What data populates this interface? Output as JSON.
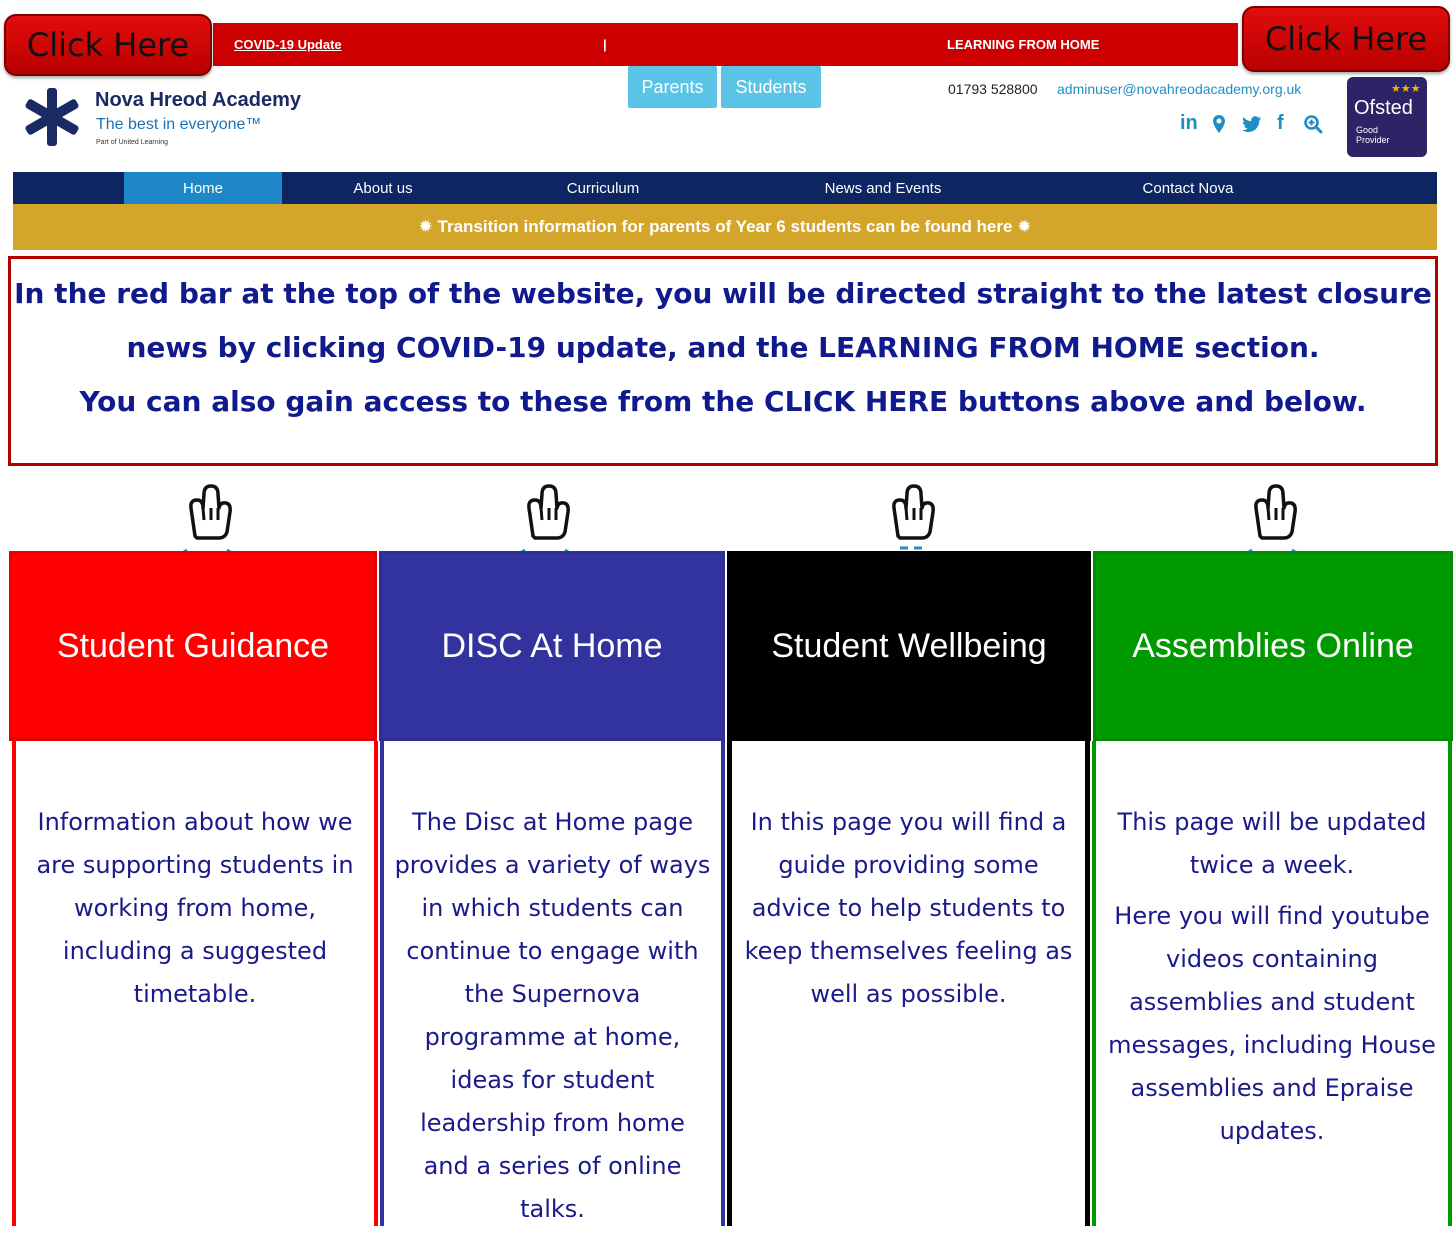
{
  "top_bar": {
    "click_left": "Click Here",
    "click_right": "Click Here",
    "covid_link": "COVID-19 Update",
    "separator": "|",
    "learning_link": "LEARNING FROM HOME"
  },
  "header": {
    "school_name": "Nova Hreod Academy",
    "tagline": "The best in everyone™",
    "sub_tagline": "Part of United Learning",
    "parents_btn": "Parents",
    "students_btn": "Students",
    "phone": "01793 528800",
    "email": "adminuser@novahreodacademy.org.uk",
    "ofsted_name": "Ofsted",
    "ofsted_sub1": "Good",
    "ofsted_sub2": "Provider"
  },
  "nav": {
    "items": [
      "Home",
      "About us",
      "Curriculum",
      "News and Events",
      "Contact Nova"
    ]
  },
  "banner": "✹ Transition information for parents of Year 6 students can be found here ✹",
  "info": {
    "line1": "In the red bar at the top of the website, you will be directed straight to the latest closure",
    "line2": "news by clicking COVID-19 update, and the LEARNING FROM HOME section.",
    "line3": "You can also gain access to these from the CLICK HERE buttons above and below."
  },
  "cards": [
    {
      "title": "Student Guidance",
      "color": "#ff0000",
      "text": [
        "Information about how we are supporting students in working from home, including a suggested timetable."
      ]
    },
    {
      "title": "DISC At Home",
      "color": "#3333a0",
      "text": [
        "The Disc at Home page provides a variety of ways in which students can continue to engage with the Supernova programme at home, ideas for student leadership from home and a series of online talks."
      ]
    },
    {
      "title": "Student Wellbeing",
      "color": "#000000",
      "text": [
        "In this page you will find a guide providing some advice to help students to keep themselves feeling as well as possible."
      ]
    },
    {
      "title": "Assemblies Online",
      "color": "#009900",
      "text": [
        "This page will be updated twice a week.",
        "Here you will find youtube videos containing assemblies and student messages, including House assemblies and Epraise updates."
      ]
    }
  ]
}
